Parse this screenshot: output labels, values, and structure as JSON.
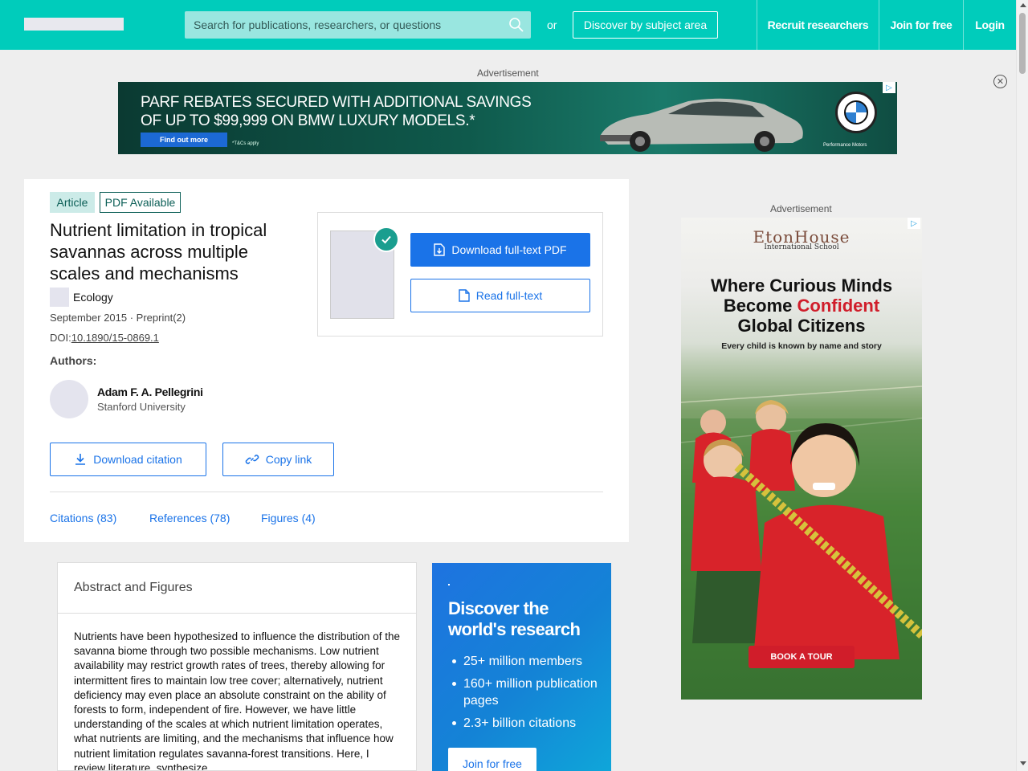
{
  "header": {
    "search_placeholder": "Search for publications, researchers, or questions",
    "or_text": "or",
    "discover_label": "Discover by subject area",
    "nav": [
      "Recruit researchers",
      "Join for free",
      "Login"
    ]
  },
  "ads": {
    "label": "Advertisement",
    "top": {
      "headline_line1": "PARF REBATES SECURED WITH ADDITIONAL SAVINGS",
      "headline_line2": "OF UP TO $99,999 ON BMW LUXURY MODELS.*",
      "cta": "Find out more",
      "fine_print": "*T&Cs apply",
      "dealer": "Performance Motors"
    },
    "side": {
      "brand": "EtonHouse",
      "brand_sub": "International School",
      "tagline_1": "Where Curious Minds",
      "tagline_2a": "Become ",
      "tagline_2b": "Confident",
      "tagline_3": "Global Citizens",
      "subline": "Every child is known by name and story",
      "cta": "BOOK A TOUR"
    }
  },
  "article": {
    "badges": [
      "Article",
      "PDF Available"
    ],
    "title": "Nutrient limitation in tropical savannas across multiple scales and mechanisms",
    "journal": "Ecology",
    "meta": "September 2015 · Preprint(2)",
    "doi_prefix": "DOI:",
    "doi": "10.1890/15-0869.1",
    "authors_label": "Authors:",
    "author": {
      "name": "Adam F. A. Pellegrini",
      "institution": "Stanford University"
    },
    "buttons": {
      "download_pdf": "Download full-text PDF",
      "read_full": "Read full-text",
      "download_citation": "Download citation",
      "copy_link": "Copy link"
    },
    "tabs": [
      "Citations (83)",
      "References (78)",
      "Figures (4)"
    ]
  },
  "abstract": {
    "heading": "Abstract and Figures",
    "text": "Nutrients have been hypothesized to influence the distribution of the savanna biome through two possible mechanisms. Low nutrient availability may restrict growth rates of trees, thereby allowing for intermittent fires to maintain low tree cover; alternatively, nutrient deficiency may even place an absolute constraint on the ability of forests to form, independent of fire. However, we have little understanding of the scales at which nutrient limitation operates, what nutrients are limiting, and the mechanisms that influence how nutrient limitation regulates savanna-forest transitions. Here, I review literature, synthesize"
  },
  "promo": {
    "heading": "Discover the world's research",
    "items": [
      "25+ million members",
      "160+ million publication pages",
      "2.3+ billion citations"
    ],
    "cta": "Join for free"
  },
  "colors": {
    "brand": "#00ccbb",
    "primary": "#1a73e8",
    "badge_bg": "#ccebe8",
    "badge_text": "#0c5f57"
  }
}
